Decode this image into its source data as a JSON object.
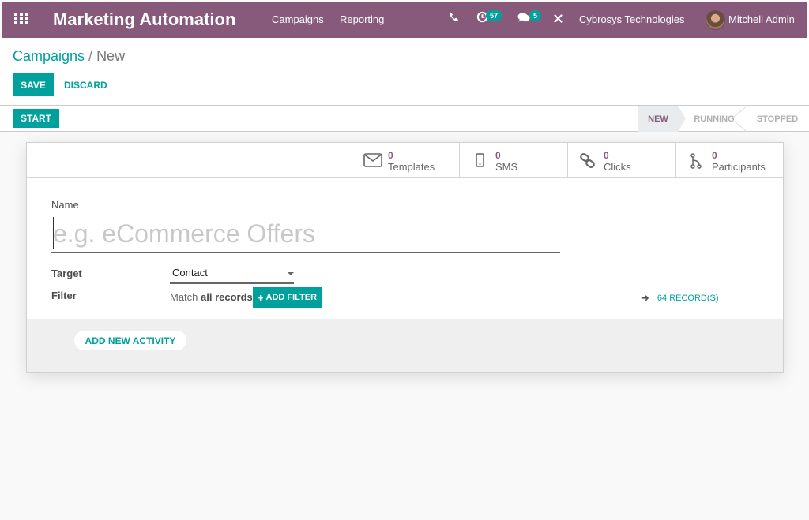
{
  "navbar": {
    "app_title": "Marketing Automation",
    "menu": [
      "Campaigns",
      "Reporting"
    ],
    "activity_count": "57",
    "message_count": "5",
    "company": "Cybrosys Technologies",
    "user": "Mitchell Admin",
    "icons": [
      "apps-grid-icon",
      "phone-icon",
      "clock-icon",
      "chat-icon",
      "debug-tools-icon"
    ]
  },
  "breadcrumb": {
    "parent": "Campaigns",
    "separator": "/",
    "current": "New"
  },
  "toolbar": {
    "save_label": "SAVE",
    "discard_label": "DISCARD"
  },
  "statusbar": {
    "start_label": "START",
    "stages": [
      "NEW",
      "RUNNING",
      "STOPPED"
    ],
    "active_stage": "NEW"
  },
  "stat_buttons": [
    {
      "icon": "envelope-icon",
      "value": "0",
      "label": "Templates"
    },
    {
      "icon": "mobile-icon",
      "value": "0",
      "label": "SMS"
    },
    {
      "icon": "link-icon",
      "value": "0",
      "label": "Clicks"
    },
    {
      "icon": "code-fork-icon",
      "value": "0",
      "label": "Participants"
    }
  ],
  "form": {
    "name_label": "Name",
    "name_value": "",
    "name_placeholder": "e.g. eCommerce Offers",
    "target_label": "Target",
    "target_value": "Contact",
    "filter_label": "Filter",
    "filter_match_prefix": "Match",
    "filter_match_value": "all records",
    "add_filter_label": "ADD FILTER",
    "records_label": "64 RECORD(S)"
  },
  "activities": {
    "add_label": "ADD NEW ACTIVITY"
  },
  "colors": {
    "brand": "#875a7b",
    "accent": "#00a09d"
  }
}
